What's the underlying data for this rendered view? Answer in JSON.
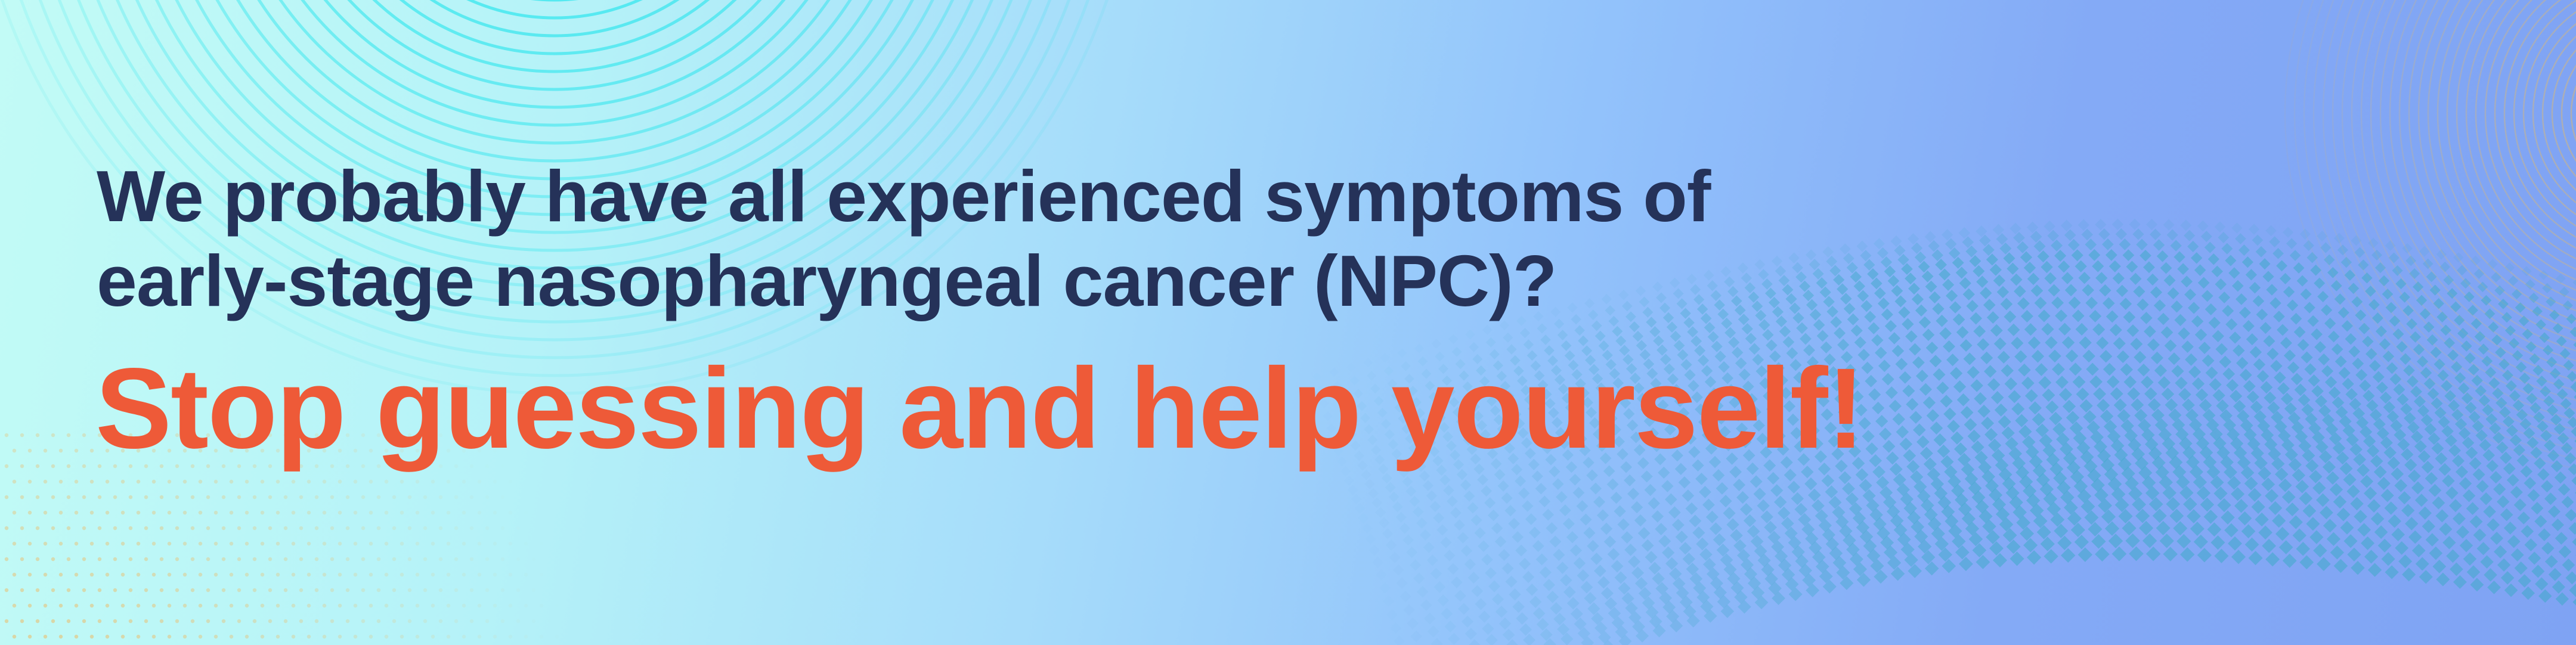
{
  "banner": {
    "headline_line1": "We probably have all experienced symptoms of",
    "headline_line2": "early-stage nasopharyngeal cancer (NPC)?",
    "tagline": "Stop guessing and help yourself!"
  },
  "colors": {
    "headline": "#253259",
    "tagline": "#ee5a38",
    "ring_cyan": "#22e4ec",
    "ring_gold": "#d8b877",
    "diamond_teal": "#3fa9c9",
    "dot_gold": "#e7c37a"
  }
}
